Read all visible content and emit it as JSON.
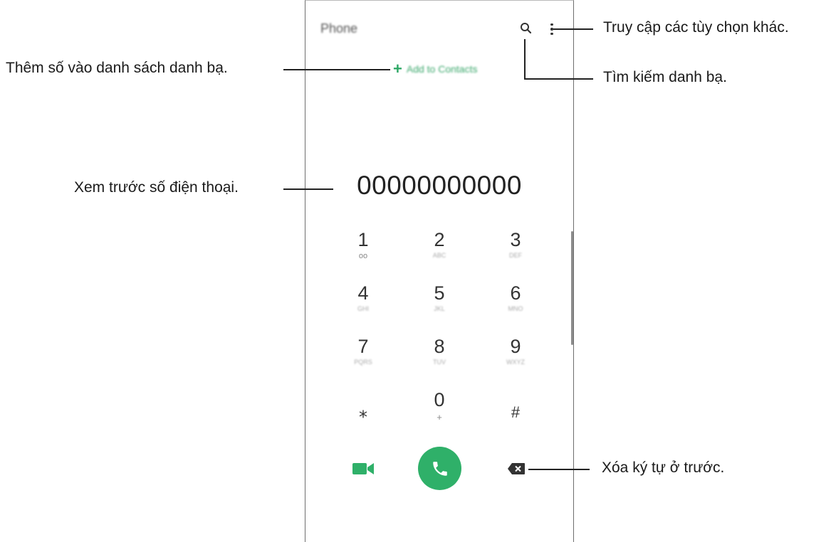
{
  "app": {
    "title": "Phone",
    "add_to_contacts": "Add to Contacts",
    "add_icon": "+",
    "number_preview": "00000000000"
  },
  "keypad": [
    {
      "digit": "1",
      "letters": "oo"
    },
    {
      "digit": "2",
      "letters": "ABC"
    },
    {
      "digit": "3",
      "letters": "DEF"
    },
    {
      "digit": "4",
      "letters": "GHI"
    },
    {
      "digit": "5",
      "letters": "JKL"
    },
    {
      "digit": "6",
      "letters": "MNO"
    },
    {
      "digit": "7",
      "letters": "PQRS"
    },
    {
      "digit": "8",
      "letters": "TUV"
    },
    {
      "digit": "9",
      "letters": "WXYZ"
    },
    {
      "digit": "⁎",
      "letters": ""
    },
    {
      "digit": "0",
      "letters": "+"
    },
    {
      "digit": "#",
      "letters": ""
    }
  ],
  "icons": {
    "search": "search-icon",
    "more": "more-options-icon",
    "video": "video-call-icon",
    "call": "phone-call-icon",
    "backspace": "backspace-icon"
  },
  "colors": {
    "accent_green": "#2fb069"
  },
  "callouts": {
    "more_options": "Truy cập các tùy chọn khác.",
    "search": "Tìm kiếm danh bạ.",
    "add_contact": "Thêm số vào danh sách danh bạ.",
    "preview": "Xem trước số điện thoại.",
    "delete": "Xóa ký tự ở trước."
  }
}
